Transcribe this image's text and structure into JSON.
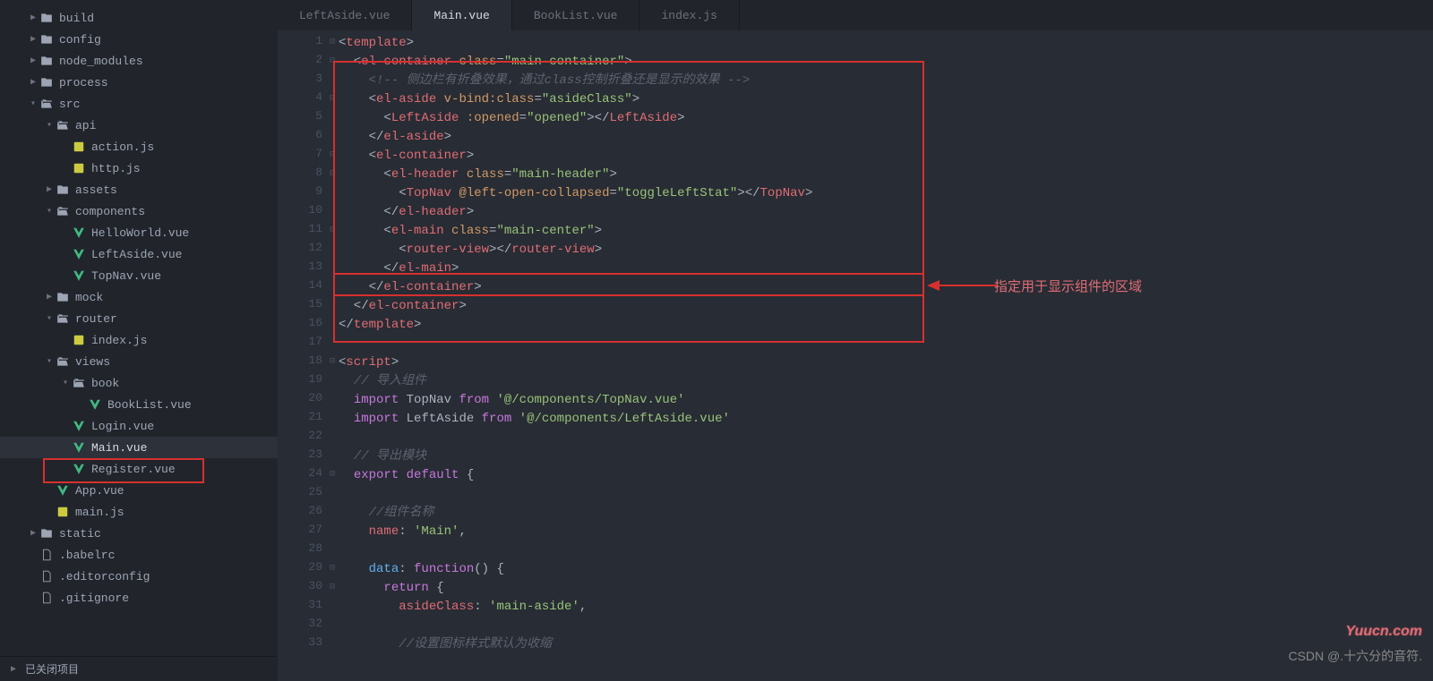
{
  "sidebar": {
    "tree": [
      {
        "depth": 1,
        "arrow": "right",
        "icon": "folder",
        "label": "build"
      },
      {
        "depth": 1,
        "arrow": "right",
        "icon": "folder",
        "label": "config"
      },
      {
        "depth": 1,
        "arrow": "right",
        "icon": "folder",
        "label": "node_modules"
      },
      {
        "depth": 1,
        "arrow": "right",
        "icon": "folder",
        "label": "process"
      },
      {
        "depth": 1,
        "arrow": "down",
        "icon": "folder-open",
        "label": "src"
      },
      {
        "depth": 2,
        "arrow": "down",
        "icon": "folder-open",
        "label": "api"
      },
      {
        "depth": 3,
        "arrow": "",
        "icon": "js",
        "label": "action.js"
      },
      {
        "depth": 3,
        "arrow": "",
        "icon": "js",
        "label": "http.js"
      },
      {
        "depth": 2,
        "arrow": "right",
        "icon": "folder",
        "label": "assets"
      },
      {
        "depth": 2,
        "arrow": "down",
        "icon": "folder-open",
        "label": "components"
      },
      {
        "depth": 3,
        "arrow": "",
        "icon": "vue",
        "label": "HelloWorld.vue"
      },
      {
        "depth": 3,
        "arrow": "",
        "icon": "vue",
        "label": "LeftAside.vue"
      },
      {
        "depth": 3,
        "arrow": "",
        "icon": "vue",
        "label": "TopNav.vue"
      },
      {
        "depth": 2,
        "arrow": "right",
        "icon": "folder",
        "label": "mock"
      },
      {
        "depth": 2,
        "arrow": "down",
        "icon": "folder-open",
        "label": "router"
      },
      {
        "depth": 3,
        "arrow": "",
        "icon": "js",
        "label": "index.js"
      },
      {
        "depth": 2,
        "arrow": "down",
        "icon": "folder-open",
        "label": "views"
      },
      {
        "depth": 3,
        "arrow": "down",
        "icon": "folder-open",
        "label": "book"
      },
      {
        "depth": 4,
        "arrow": "",
        "icon": "vue",
        "label": "BookList.vue"
      },
      {
        "depth": 3,
        "arrow": "",
        "icon": "vue",
        "label": "Login.vue"
      },
      {
        "depth": 3,
        "arrow": "",
        "icon": "vue",
        "label": "Main.vue",
        "active": true
      },
      {
        "depth": 3,
        "arrow": "",
        "icon": "vue",
        "label": "Register.vue"
      },
      {
        "depth": 2,
        "arrow": "",
        "icon": "vue",
        "label": "App.vue"
      },
      {
        "depth": 2,
        "arrow": "",
        "icon": "js",
        "label": "main.js"
      },
      {
        "depth": 1,
        "arrow": "right",
        "icon": "folder",
        "label": "static"
      },
      {
        "depth": 1,
        "arrow": "",
        "icon": "file",
        "label": ".babelrc"
      },
      {
        "depth": 1,
        "arrow": "",
        "icon": "file",
        "label": ".editorconfig"
      },
      {
        "depth": 1,
        "arrow": "",
        "icon": "file",
        "label": ".gitignore"
      }
    ],
    "closed_projects": "已关闭项目"
  },
  "tabs": [
    {
      "label": "LeftAside.vue"
    },
    {
      "label": "Main.vue",
      "active": true
    },
    {
      "label": "BookList.vue"
    },
    {
      "label": "index.js"
    }
  ],
  "code": [
    {
      "n": 1,
      "fold": "−",
      "tokens": [
        [
          "p",
          "<"
        ],
        [
          "tg",
          "template"
        ],
        [
          "p",
          ">"
        ]
      ]
    },
    {
      "n": 2,
      "fold": "−",
      "tokens": [
        [
          "p",
          "  <"
        ],
        [
          "tg",
          "el-container"
        ],
        [
          "p",
          " "
        ],
        [
          "at",
          "class"
        ],
        [
          "p",
          "="
        ],
        [
          "st",
          "\"main-container\""
        ],
        [
          "p",
          ">"
        ]
      ]
    },
    {
      "n": 3,
      "tokens": [
        [
          "p",
          "    "
        ],
        [
          "cm",
          "<!-- 侧边栏有折叠效果，通过class控制折叠还是显示的效果 -->"
        ]
      ]
    },
    {
      "n": 4,
      "fold": "−",
      "tokens": [
        [
          "p",
          "    <"
        ],
        [
          "tg",
          "el-aside"
        ],
        [
          "p",
          " "
        ],
        [
          "at",
          "v-bind:class"
        ],
        [
          "p",
          "="
        ],
        [
          "st",
          "\"asideClass\""
        ],
        [
          "p",
          ">"
        ]
      ]
    },
    {
      "n": 5,
      "tokens": [
        [
          "p",
          "      <"
        ],
        [
          "tg",
          "LeftAside"
        ],
        [
          "p",
          " "
        ],
        [
          "at",
          ":opened"
        ],
        [
          "p",
          "="
        ],
        [
          "st",
          "\"opened\""
        ],
        [
          "p",
          "></"
        ],
        [
          "tg",
          "LeftAside"
        ],
        [
          "p",
          ">"
        ]
      ]
    },
    {
      "n": 6,
      "tokens": [
        [
          "p",
          "    </"
        ],
        [
          "tg",
          "el-aside"
        ],
        [
          "p",
          ">"
        ]
      ]
    },
    {
      "n": 7,
      "fold": "−",
      "tokens": [
        [
          "p",
          "    <"
        ],
        [
          "tg",
          "el-container"
        ],
        [
          "p",
          ">"
        ]
      ]
    },
    {
      "n": 8,
      "fold": "−",
      "tokens": [
        [
          "p",
          "      <"
        ],
        [
          "tg",
          "el-header"
        ],
        [
          "p",
          " "
        ],
        [
          "at",
          "class"
        ],
        [
          "p",
          "="
        ],
        [
          "st",
          "\"main-header\""
        ],
        [
          "p",
          ">"
        ]
      ]
    },
    {
      "n": 9,
      "tokens": [
        [
          "p",
          "        <"
        ],
        [
          "tg",
          "TopNav"
        ],
        [
          "p",
          " "
        ],
        [
          "at",
          "@left-open-collapsed"
        ],
        [
          "p",
          "="
        ],
        [
          "st",
          "\"toggleLeftStat\""
        ],
        [
          "p",
          "></"
        ],
        [
          "tg",
          "TopNav"
        ],
        [
          "p",
          ">"
        ]
      ]
    },
    {
      "n": 10,
      "tokens": [
        [
          "p",
          "      </"
        ],
        [
          "tg",
          "el-header"
        ],
        [
          "p",
          ">"
        ]
      ]
    },
    {
      "n": 11,
      "fold": "−",
      "tokens": [
        [
          "p",
          "      <"
        ],
        [
          "tg",
          "el-main"
        ],
        [
          "p",
          " "
        ],
        [
          "at",
          "class"
        ],
        [
          "p",
          "="
        ],
        [
          "st",
          "\"main-center\""
        ],
        [
          "p",
          ">"
        ]
      ]
    },
    {
      "n": 12,
      "tokens": [
        [
          "p",
          "        <"
        ],
        [
          "tg",
          "router-view"
        ],
        [
          "p",
          "></"
        ],
        [
          "tg",
          "router-view"
        ],
        [
          "p",
          ">"
        ]
      ]
    },
    {
      "n": 13,
      "tokens": [
        [
          "p",
          "      </"
        ],
        [
          "tg",
          "el-main"
        ],
        [
          "p",
          ">"
        ]
      ]
    },
    {
      "n": 14,
      "tokens": [
        [
          "p",
          "    </"
        ],
        [
          "tg",
          "el-container"
        ],
        [
          "p",
          ">"
        ]
      ]
    },
    {
      "n": 15,
      "tokens": [
        [
          "p",
          "  </"
        ],
        [
          "tg",
          "el-container"
        ],
        [
          "p",
          ">"
        ]
      ]
    },
    {
      "n": 16,
      "tokens": [
        [
          "p",
          "</"
        ],
        [
          "tg",
          "template"
        ],
        [
          "p",
          ">"
        ]
      ]
    },
    {
      "n": 17,
      "tokens": []
    },
    {
      "n": 18,
      "fold": "−",
      "tokens": [
        [
          "p",
          "<"
        ],
        [
          "tg",
          "script"
        ],
        [
          "p",
          ">"
        ]
      ]
    },
    {
      "n": 19,
      "tokens": [
        [
          "p",
          "  "
        ],
        [
          "cm",
          "// 导入组件"
        ]
      ]
    },
    {
      "n": 20,
      "tokens": [
        [
          "p",
          "  "
        ],
        [
          "kw",
          "import"
        ],
        [
          "p",
          " TopNav "
        ],
        [
          "kw",
          "from"
        ],
        [
          "p",
          " "
        ],
        [
          "st",
          "'@/components/TopNav.vue'"
        ]
      ]
    },
    {
      "n": 21,
      "tokens": [
        [
          "p",
          "  "
        ],
        [
          "kw",
          "import"
        ],
        [
          "p",
          " LeftAside "
        ],
        [
          "kw",
          "from"
        ],
        [
          "p",
          " "
        ],
        [
          "st",
          "'@/components/LeftAside.vue'"
        ]
      ]
    },
    {
      "n": 22,
      "tokens": []
    },
    {
      "n": 23,
      "tokens": [
        [
          "p",
          "  "
        ],
        [
          "cm",
          "// 导出模块"
        ]
      ]
    },
    {
      "n": 24,
      "fold": "−",
      "tokens": [
        [
          "p",
          "  "
        ],
        [
          "kw",
          "export"
        ],
        [
          "p",
          " "
        ],
        [
          "kw",
          "default"
        ],
        [
          "p",
          " {"
        ]
      ]
    },
    {
      "n": 25,
      "tokens": []
    },
    {
      "n": 26,
      "tokens": [
        [
          "p",
          "    "
        ],
        [
          "cm",
          "//组件名称"
        ]
      ]
    },
    {
      "n": 27,
      "tokens": [
        [
          "p",
          "    "
        ],
        [
          "va",
          "name"
        ],
        [
          "p",
          ": "
        ],
        [
          "st",
          "'Main'"
        ],
        [
          "p",
          ","
        ]
      ]
    },
    {
      "n": 28,
      "tokens": []
    },
    {
      "n": 29,
      "fold": "−",
      "tokens": [
        [
          "p",
          "    "
        ],
        [
          "fn",
          "data"
        ],
        [
          "p",
          ": "
        ],
        [
          "kw",
          "function"
        ],
        [
          "p",
          "() {"
        ]
      ]
    },
    {
      "n": 30,
      "fold": "−",
      "tokens": [
        [
          "p",
          "      "
        ],
        [
          "kw",
          "return"
        ],
        [
          "p",
          " {"
        ]
      ]
    },
    {
      "n": 31,
      "tokens": [
        [
          "p",
          "        "
        ],
        [
          "va",
          "asideClass"
        ],
        [
          "p",
          ": "
        ],
        [
          "st",
          "'main-aside'"
        ],
        [
          "p",
          ","
        ]
      ]
    },
    {
      "n": 32,
      "tokens": []
    },
    {
      "n": 33,
      "tokens": [
        [
          "p",
          "        "
        ],
        [
          "cm",
          "//设置图标样式默认为收缩"
        ]
      ]
    }
  ],
  "annotation": "指定用于显示组件的区域",
  "watermarks": {
    "top": "Yuucn.com",
    "bottom": "CSDN @.十六分的音符."
  }
}
